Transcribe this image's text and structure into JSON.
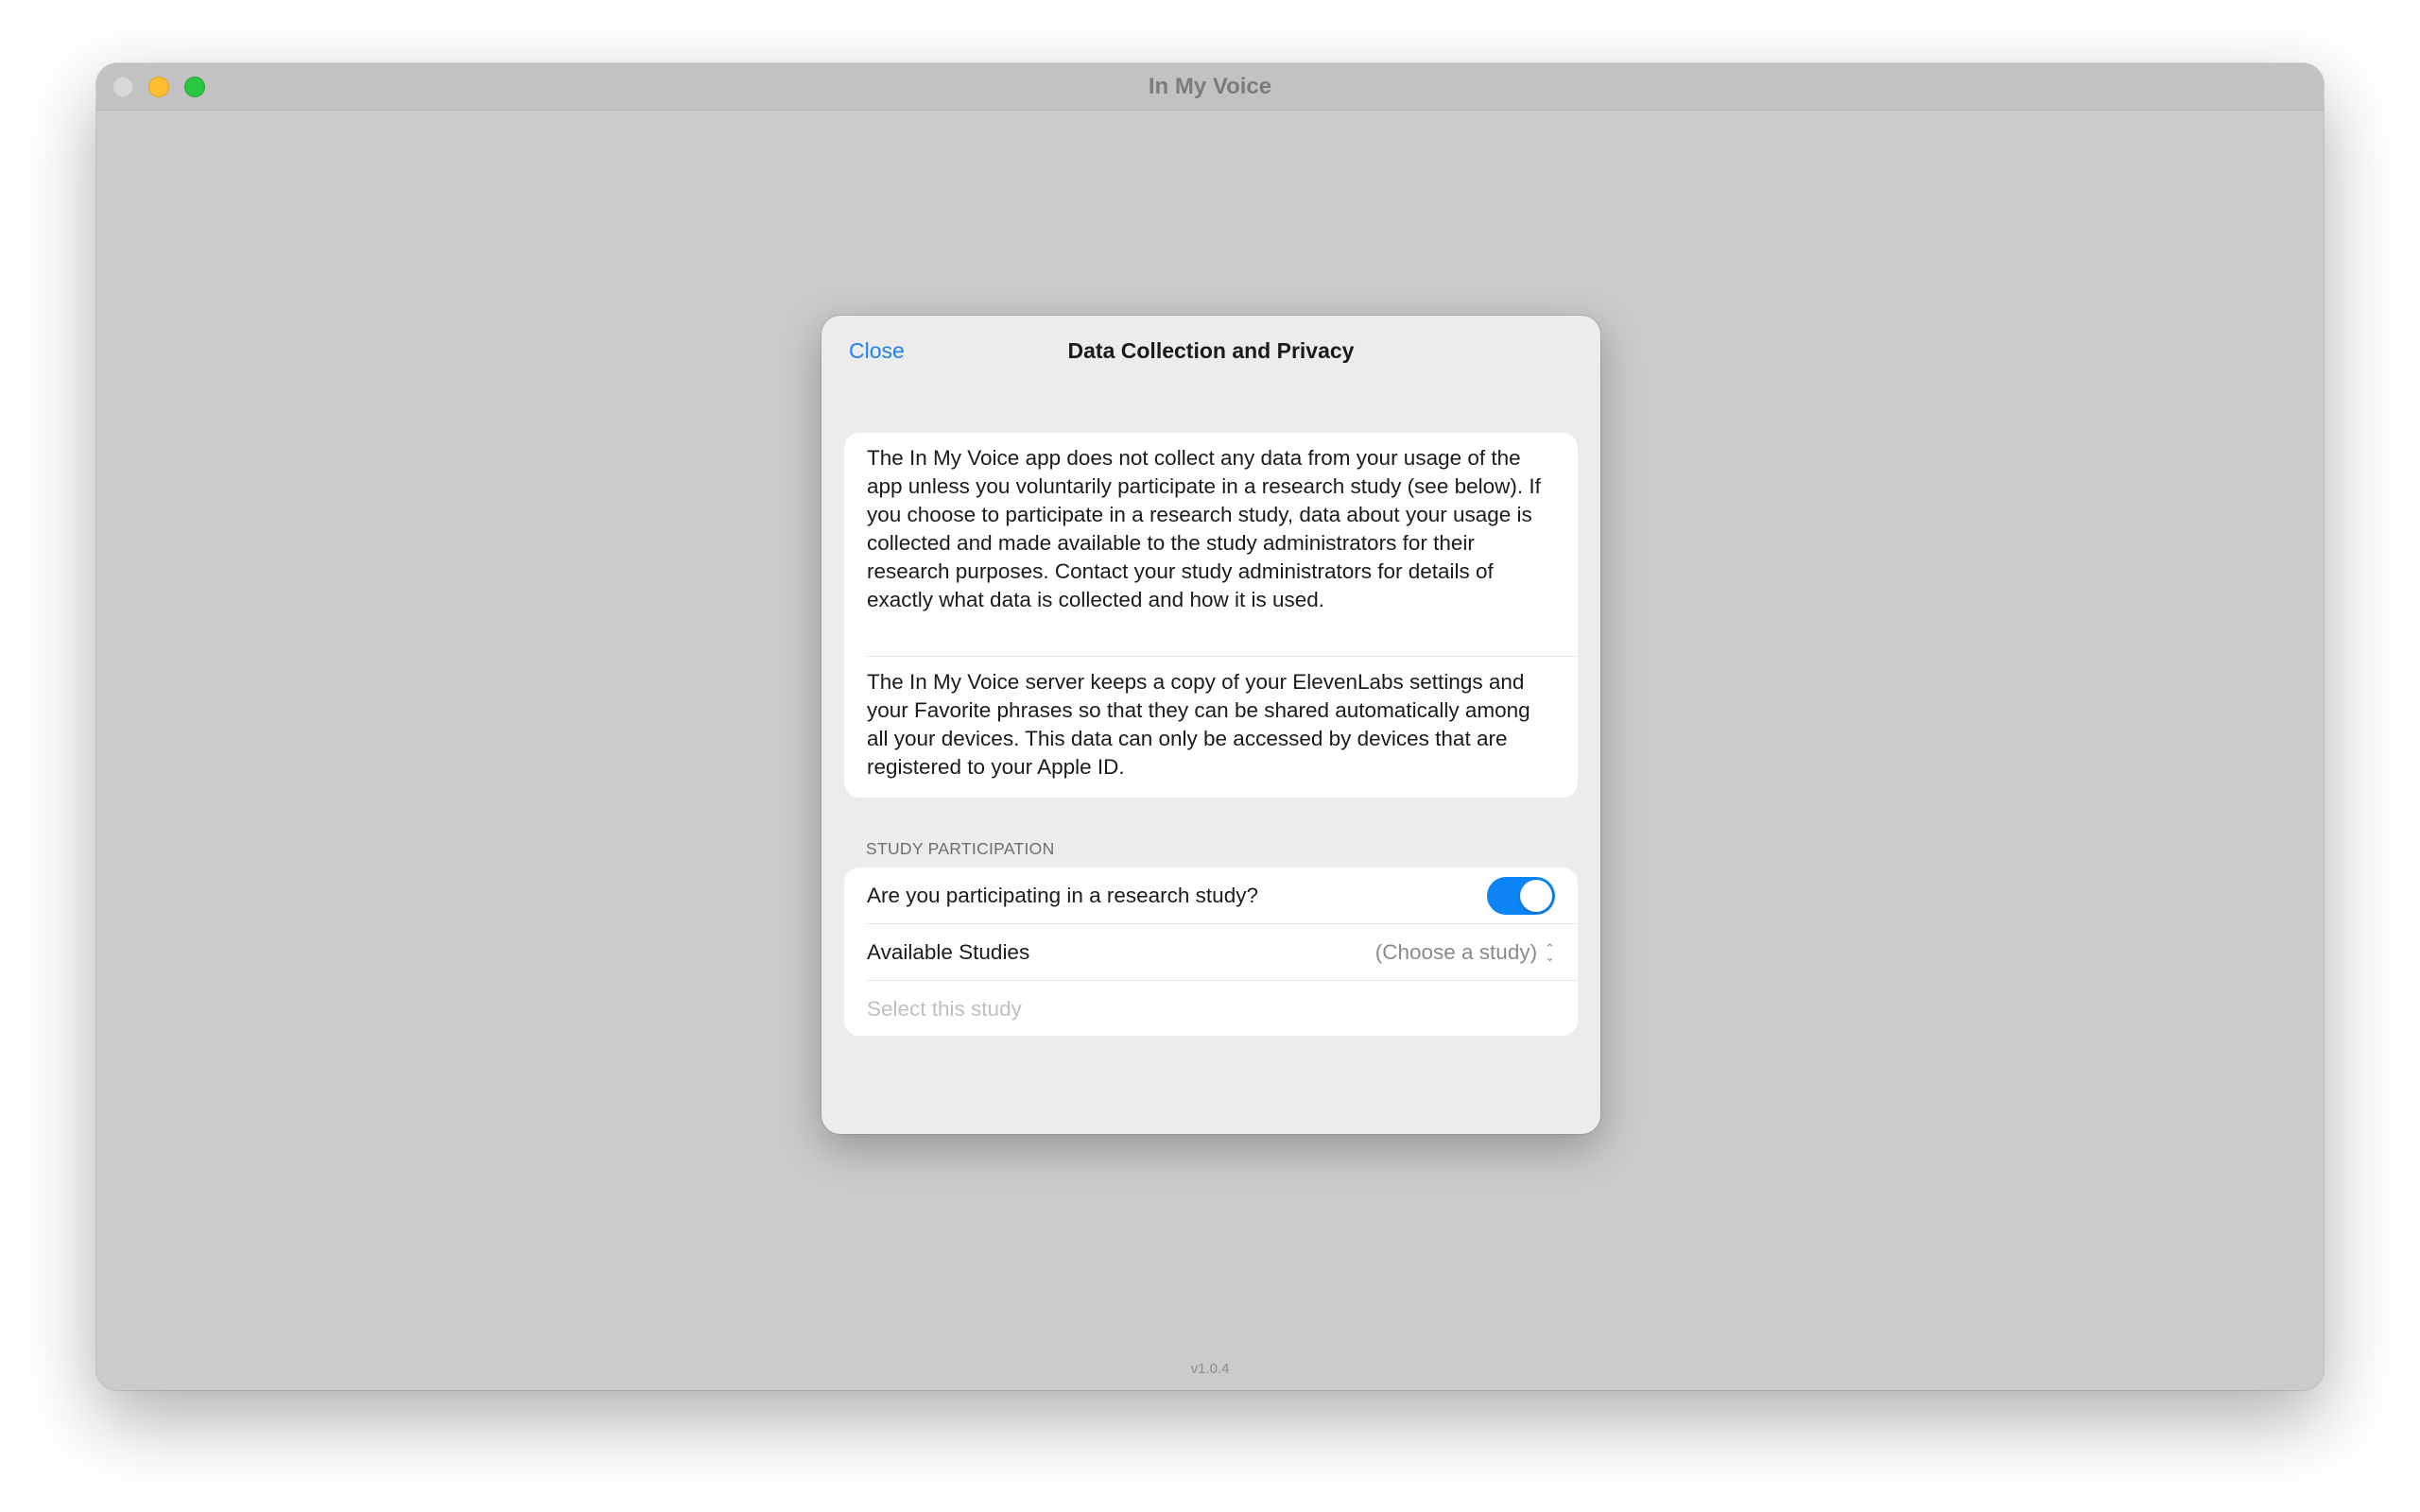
{
  "window": {
    "title": "In My Voice",
    "version": "v1.0.4"
  },
  "sheet": {
    "close_label": "Close",
    "title": "Data Collection and Privacy"
  },
  "info": {
    "paragraph1": "The In My Voice app does not collect any data from your usage of the app unless you voluntarily participate in a research study (see below). If you choose to participate in a research study, data about your usage is collected and made available to the study administrators for their research purposes. Contact your study administrators for details of exactly what data is collected and how it is used.",
    "paragraph2": "The In My Voice server keeps a copy of your ElevenLabs settings and your Favorite phrases so that they can be shared automatically among all your devices. This data can only be accessed by devices that are registered to your Apple ID."
  },
  "study": {
    "section_label": "STUDY PARTICIPATION",
    "participating_label": "Are you participating in a research study?",
    "participating_on": true,
    "available_label": "Available Studies",
    "available_value": "(Choose a study)",
    "select_label": "Select this study"
  },
  "colors": {
    "accent": "#1c82f4",
    "toggle_on": "#0d84f5",
    "window_bg": "#cbcbcb",
    "sheet_bg": "#ececec"
  },
  "icons": {
    "picker": "chevron-up-down-icon"
  }
}
